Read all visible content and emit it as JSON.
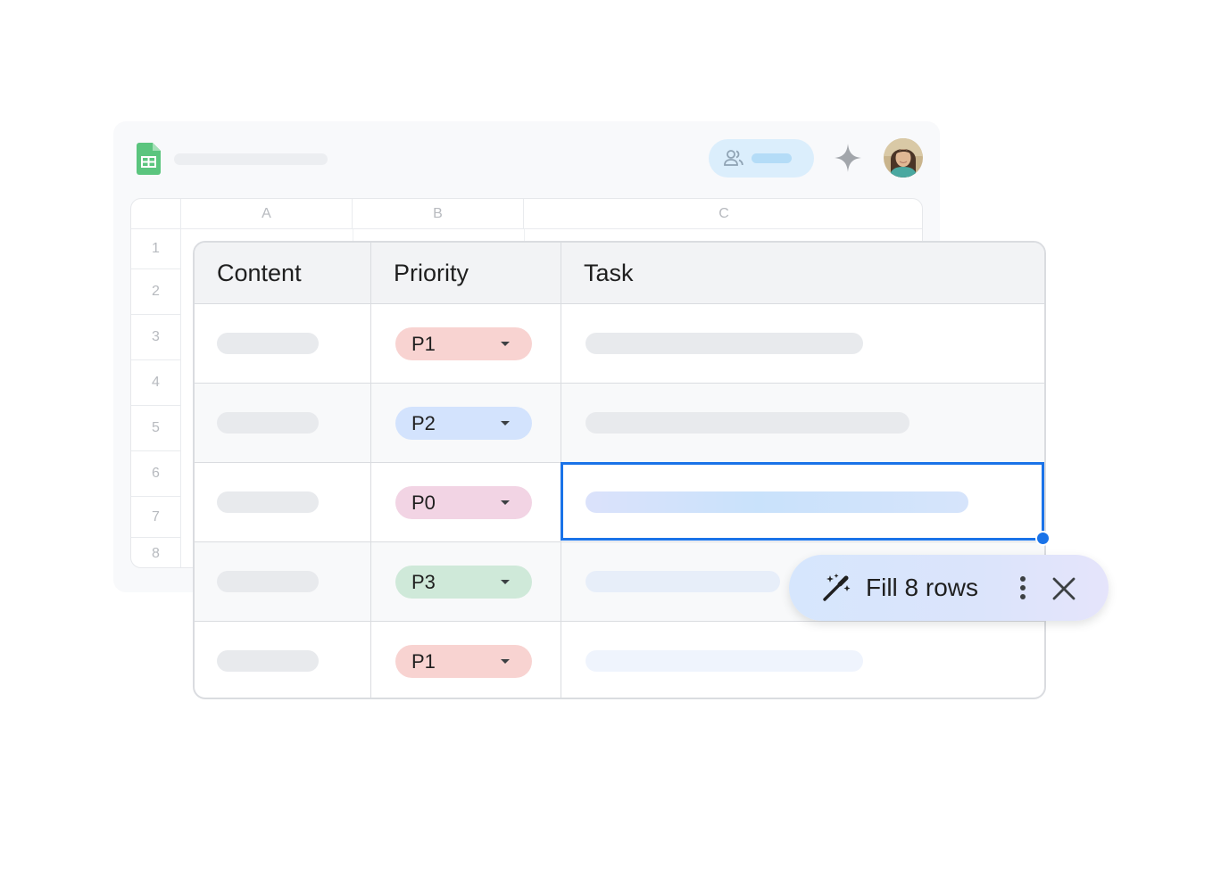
{
  "background_sheet": {
    "columns": [
      "A",
      "B",
      "C"
    ],
    "rows": [
      "1",
      "2",
      "3",
      "4",
      "5",
      "6",
      "7",
      "8"
    ]
  },
  "table": {
    "headers": {
      "content": "Content",
      "priority": "Priority",
      "task": "Task"
    },
    "rows": [
      {
        "priority": "P1",
        "chip_color": "#f8d3d1"
      },
      {
        "priority": "P2",
        "chip_color": "#d3e3fd"
      },
      {
        "priority": "P0",
        "chip_color": "#f2d4e4"
      },
      {
        "priority": "P3",
        "chip_color": "#cfe9d9"
      },
      {
        "priority": "P1",
        "chip_color": "#f8d3d1"
      }
    ]
  },
  "fill_action": {
    "label": "Fill 8 rows",
    "icons": [
      "magic-wand-icon",
      "more-vert-icon",
      "close-icon"
    ]
  },
  "colors": {
    "accent": "#1a73e8",
    "sheets_green": "#34a853"
  }
}
